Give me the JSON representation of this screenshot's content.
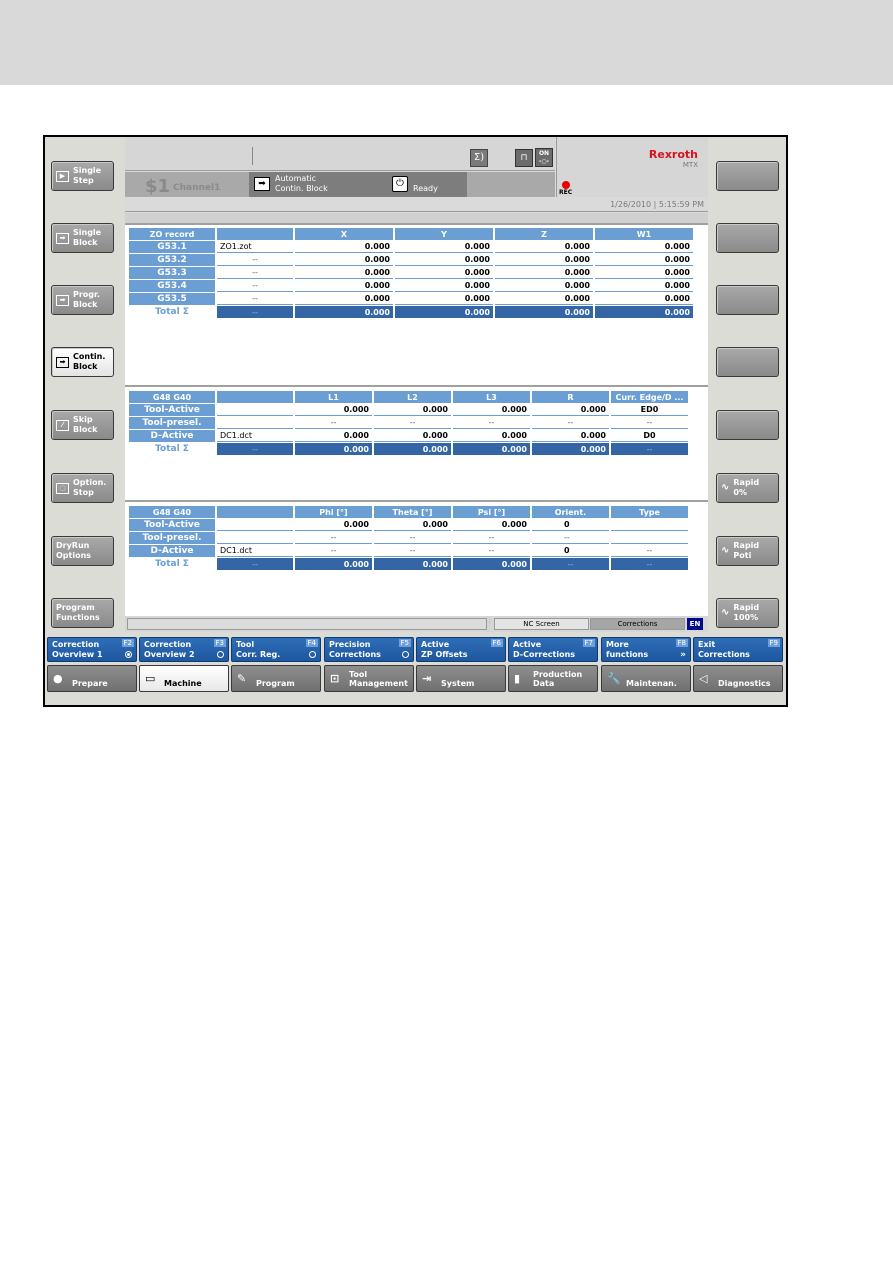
{
  "header": {
    "channel_number": "$1",
    "channel_name": "Channel1",
    "mode_line1": "Automatic",
    "mode_line2": "Contin. Block",
    "status": "Ready",
    "brand": "Rexroth",
    "brand_sub": "MTX",
    "rec_label": "REC",
    "datetime": "1/26/2010 | 5:15:59 PM",
    "icons": {
      "sigma": "Σ)",
      "lock": "🔒",
      "on": "ON"
    }
  },
  "left_softkeys": [
    {
      "label": "Single\nStep",
      "icon": "single-step"
    },
    {
      "label": "Single\nBlock",
      "icon": "single-block"
    },
    {
      "label": "Progr.\nBlock",
      "icon": "progr-block"
    },
    {
      "label": "Contin.\nBlock",
      "icon": "contin-block",
      "active": true
    },
    {
      "label": "Skip\nBlock",
      "icon": "skip-block"
    },
    {
      "label": "Option.\nStop",
      "icon": "option-stop"
    },
    {
      "label": "DryRun\nOptions",
      "icon": ""
    },
    {
      "label": "Program\nFunctions",
      "icon": ""
    }
  ],
  "right_softkeys": [
    {
      "label": ""
    },
    {
      "label": ""
    },
    {
      "label": ""
    },
    {
      "label": ""
    },
    {
      "label": ""
    },
    {
      "label": "Rapid\n0%",
      "icon": "wave"
    },
    {
      "label": "Rapid\nPoti",
      "icon": "wave"
    },
    {
      "label": "Rapid\n100%",
      "icon": "wave"
    }
  ],
  "zo_table": {
    "headers": [
      "ZO record",
      "",
      "X",
      "Y",
      "Z",
      "W1"
    ],
    "rows": [
      {
        "label": "G53.1",
        "file": "ZO1.zot",
        "values": [
          "0.000",
          "0.000",
          "0.000",
          "0.000"
        ]
      },
      {
        "label": "G53.2",
        "file": "--",
        "values": [
          "0.000",
          "0.000",
          "0.000",
          "0.000"
        ]
      },
      {
        "label": "G53.3",
        "file": "--",
        "values": [
          "0.000",
          "0.000",
          "0.000",
          "0.000"
        ]
      },
      {
        "label": "G53.4",
        "file": "--",
        "values": [
          "0.000",
          "0.000",
          "0.000",
          "0.000"
        ]
      },
      {
        "label": "G53.5",
        "file": "--",
        "values": [
          "0.000",
          "0.000",
          "0.000",
          "0.000"
        ]
      }
    ],
    "total": {
      "label": "Total Σ",
      "file": "--",
      "values": [
        "0.000",
        "0.000",
        "0.000",
        "0.000"
      ]
    }
  },
  "tool_table": {
    "headers": [
      "G48 G40",
      "",
      "L1",
      "L2",
      "L3",
      "R",
      "Curr. Edge/D ..."
    ],
    "rows": [
      {
        "label": "Tool-Active",
        "file": "",
        "values": [
          "0.000",
          "0.000",
          "0.000",
          "0.000",
          "ED0"
        ]
      },
      {
        "label": "Tool-presel.",
        "file": "",
        "values": [
          "--",
          "--",
          "--",
          "--",
          "--"
        ]
      },
      {
        "label": "D-Active",
        "file": "DC1.dct",
        "values": [
          "0.000",
          "0.000",
          "0.000",
          "0.000",
          "D0"
        ]
      }
    ],
    "total": {
      "label": "Total Σ",
      "file": "--",
      "values": [
        "0.000",
        "0.000",
        "0.000",
        "0.000",
        "--"
      ]
    }
  },
  "orient_table": {
    "headers": [
      "G48 G40",
      "",
      "Phi [°]",
      "Theta [°]",
      "Psi [°]",
      "Orient.",
      "Type"
    ],
    "rows": [
      {
        "label": "Tool-Active",
        "file": "",
        "values": [
          "0.000",
          "0.000",
          "0.000",
          "0",
          ""
        ]
      },
      {
        "label": "Tool-presel.",
        "file": "",
        "values": [
          "--",
          "--",
          "--",
          "--",
          ""
        ]
      },
      {
        "label": "D-Active",
        "file": "DC1.dct",
        "values": [
          "--",
          "--",
          "--",
          "0",
          "--"
        ]
      }
    ],
    "total": {
      "label": "Total Σ",
      "file": "--",
      "values": [
        "0.000",
        "0.000",
        "0.000",
        "--",
        "--"
      ]
    }
  },
  "statusbar": {
    "nc_screen": "NC Screen",
    "corrections": "Corrections",
    "language": "EN"
  },
  "function_keys": [
    {
      "label": "Correction\nOverview 1",
      "key": "F2",
      "indicator": "radio-on"
    },
    {
      "label": "Correction\nOverview 2",
      "key": "F3",
      "indicator": "radio-off"
    },
    {
      "label": "Tool\nCorr. Reg.",
      "key": "F4",
      "indicator": "radio-off"
    },
    {
      "label": "Precision\nCorrections",
      "key": "F5",
      "indicator": "radio-off"
    },
    {
      "label": "Active\nZP Offsets",
      "key": "F6",
      "indicator": ""
    },
    {
      "label": "Active\nD-Corrections",
      "key": "F7",
      "indicator": ""
    },
    {
      "label": "More\nfunctions",
      "key": "F8",
      "indicator": "more"
    },
    {
      "label": "Exit\nCorrections",
      "key": "F9",
      "indicator": ""
    }
  ],
  "nav_keys": [
    {
      "label": "Prepare",
      "icon": "●"
    },
    {
      "label": "Machine",
      "icon": "▭",
      "active": true
    },
    {
      "label": "Program",
      "icon": "✎"
    },
    {
      "label": "Tool\nManagement",
      "icon": "⊡"
    },
    {
      "label": "System",
      "icon": "⇥"
    },
    {
      "label": "Production\nData",
      "icon": "▮"
    },
    {
      "label": "Maintenan.",
      "icon": "🔧"
    },
    {
      "label": "Diagnostics",
      "icon": "◁"
    }
  ],
  "more_glyph": "»"
}
